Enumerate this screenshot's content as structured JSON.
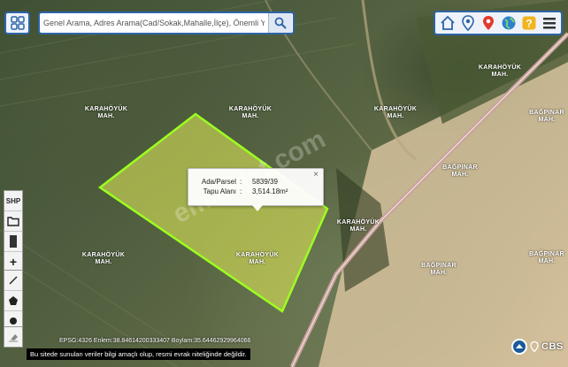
{
  "search": {
    "placeholder": "Genel Arama, Adres Arama(Cad/Sokak,Mahalle,İlçe), Önemli Yer Aranı"
  },
  "toolbar": {
    "icons": [
      "home-icon",
      "location-pin-icon",
      "marker-icon",
      "globe-icon",
      "help-icon",
      "menu-icon"
    ]
  },
  "left_tools": {
    "shp_label": "SHP"
  },
  "labels": {
    "karahoyuk": "KARAHÖYÜK MAH.",
    "bagpinar": "BAĞPINAR MAH."
  },
  "popup": {
    "row1_key": "Ada/Parsel",
    "row1_sep": ":",
    "row1_value": "5839/39",
    "row2_key": "Tapu Alanı",
    "row2_sep": ":",
    "row2_value": "3,514.18m²",
    "close": "×"
  },
  "watermark": "emlakjet.com",
  "coords": "EPSG:4326 Enlem:38.84614200333407 Boylam:35.64462929964066",
  "disclaimer": "Bu sitede sunulan veriler bilgi amaçlı olup, resmi evrak niteliğinde değildir.",
  "brand": "CBS",
  "colors": {
    "accent": "#2d64a8",
    "parcel_outline": "#9cff1f",
    "parcel_fill": "#e8f05a",
    "road": "#c9a19a"
  }
}
